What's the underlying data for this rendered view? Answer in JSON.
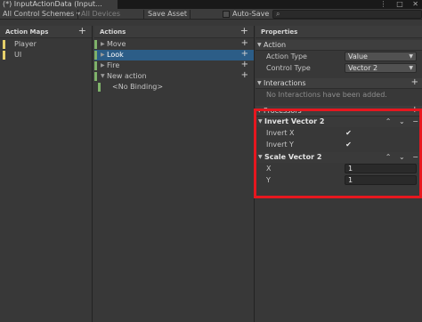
{
  "window": {
    "tab_title": "(*) InputActionData (Input...",
    "controls": [
      "⋮",
      "□",
      "✕"
    ]
  },
  "toolbar": {
    "control_schemes": "All Control Schemes ▾",
    "devices": "All Devices",
    "save_asset": "Save Asset",
    "auto_save": "Auto-Save",
    "search_icon_glyph": "⌕"
  },
  "action_maps": {
    "header": "Action Maps",
    "add_glyph": "+",
    "items": [
      {
        "label": "Player",
        "color": "#e6d06a"
      },
      {
        "label": "UI",
        "color": "#e6d06a"
      }
    ]
  },
  "actions": {
    "header": "Actions",
    "add_glyph": "+",
    "items": [
      {
        "label": "Move",
        "selected": false
      },
      {
        "label": "Look",
        "selected": true
      },
      {
        "label": "Fire",
        "selected": false
      },
      {
        "label": "New action",
        "selected": false,
        "expanded": true
      }
    ],
    "binding": "<No Binding>"
  },
  "properties": {
    "header": "Properties",
    "action_section": "Action",
    "action_type_label": "Action Type",
    "action_type_value": "Value",
    "control_type_label": "Control Type",
    "control_type_value": "Vector 2",
    "interactions_section": "Interactions",
    "interactions_empty": "No Interactions have been added.",
    "processors_section": "Processors",
    "processors": [
      {
        "title": "Invert Vector 2",
        "fields": [
          {
            "label": "Invert X",
            "checked": true
          },
          {
            "label": "Invert Y",
            "checked": true
          }
        ]
      },
      {
        "title": "Scale Vector 2",
        "fields": [
          {
            "label": "X",
            "value": "1"
          },
          {
            "label": "Y",
            "value": "1"
          }
        ]
      }
    ]
  },
  "glyphs": {
    "plus": "+",
    "up": "⌃",
    "down": "⌄",
    "minus": "−",
    "check": "✔",
    "tri_down": "▼",
    "tri_right": "▶"
  },
  "colors": {
    "selection": "#2c5d87",
    "highlight_border": "#e6171f",
    "map_marker": "#e6d06a",
    "action_marker": "#7fb26a"
  }
}
